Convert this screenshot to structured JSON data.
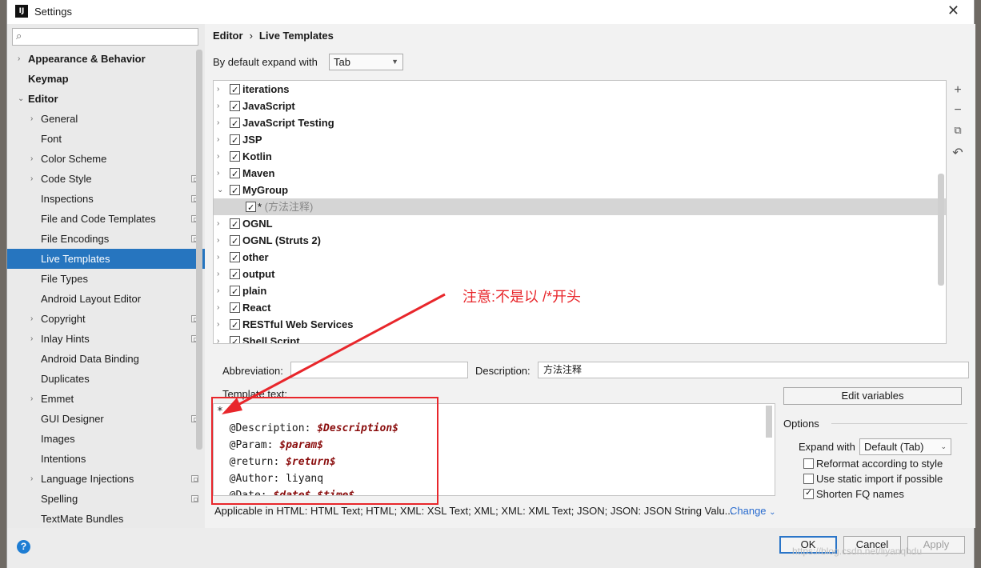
{
  "window": {
    "title": "Settings",
    "logo": "IJ"
  },
  "search": {
    "placeholder": ""
  },
  "sidebar": {
    "items": [
      {
        "label": "Appearance & Behavior"
      },
      {
        "label": "Keymap"
      },
      {
        "label": "Editor"
      },
      {
        "label": "General"
      },
      {
        "label": "Font"
      },
      {
        "label": "Color Scheme"
      },
      {
        "label": "Code Style"
      },
      {
        "label": "Inspections"
      },
      {
        "label": "File and Code Templates"
      },
      {
        "label": "File Encodings"
      },
      {
        "label": "Live Templates"
      },
      {
        "label": "File Types"
      },
      {
        "label": "Android Layout Editor"
      },
      {
        "label": "Copyright"
      },
      {
        "label": "Inlay Hints"
      },
      {
        "label": "Android Data Binding"
      },
      {
        "label": "Duplicates"
      },
      {
        "label": "Emmet"
      },
      {
        "label": "GUI Designer"
      },
      {
        "label": "Images"
      },
      {
        "label": "Intentions"
      },
      {
        "label": "Language Injections"
      },
      {
        "label": "Spelling"
      },
      {
        "label": "TextMate Bundles"
      }
    ]
  },
  "breadcrumb": {
    "parent": "Editor",
    "separator": "›",
    "current": "Live Templates"
  },
  "expand": {
    "label": "By default expand with",
    "value": "Tab"
  },
  "groups": [
    {
      "name": "iterations"
    },
    {
      "name": "JavaScript"
    },
    {
      "name": "JavaScript Testing"
    },
    {
      "name": "JSP"
    },
    {
      "name": "Kotlin"
    },
    {
      "name": "Maven"
    },
    {
      "name": "MyGroup"
    },
    {
      "name": "*",
      "desc": " (方法注释)"
    },
    {
      "name": "OGNL"
    },
    {
      "name": "OGNL (Struts 2)"
    },
    {
      "name": "other"
    },
    {
      "name": "output"
    },
    {
      "name": "plain"
    },
    {
      "name": "React"
    },
    {
      "name": "RESTful Web Services"
    },
    {
      "name": "Shell Script"
    }
  ],
  "toolbar": {
    "add": "+",
    "remove": "−",
    "copy": "⧉",
    "restore": "↶"
  },
  "abbreviation": {
    "label": "Abbreviation:",
    "value": ""
  },
  "description": {
    "label": "Description:",
    "value": "方法注释"
  },
  "template_text": {
    "label": "Template text:",
    "lines": [
      {
        "plain": "*"
      },
      {
        "plain": ""
      },
      {
        "plain": "  @Description: ",
        "var": "$Description$"
      },
      {
        "plain": "  @Param: ",
        "var": "$param$"
      },
      {
        "plain": "  @return: ",
        "var": "$return$"
      },
      {
        "plain": "  @Author: liyanq"
      },
      {
        "plain": "  @Date: ",
        "var": "$date$ $time$"
      }
    ]
  },
  "edit_variables": "Edit variables",
  "options": {
    "title": "Options",
    "expand_label": "Expand with",
    "expand_value": "Default (Tab)",
    "reformat": {
      "label": "Reformat according to style",
      "checked": false
    },
    "static_import": {
      "label": "Use static import if possible",
      "checked": false
    },
    "shorten_fq": {
      "label": "Shorten FQ names",
      "checked": true
    }
  },
  "applicable": "Applicable in HTML: HTML Text; HTML; XML: XSL Text; XML; XML: XML Text; JSON; JSON: JSON String Valu...",
  "change_link": "Change",
  "buttons": {
    "ok": "OK",
    "cancel": "Cancel",
    "apply": "Apply"
  },
  "annotation": "注意:不是以 /*开头",
  "watermark": "https://blog.csdn.net/liyanqhdu",
  "colors": {
    "selection": "#2675bf",
    "annotation": "#e8262b",
    "link": "#2a6ccf"
  }
}
